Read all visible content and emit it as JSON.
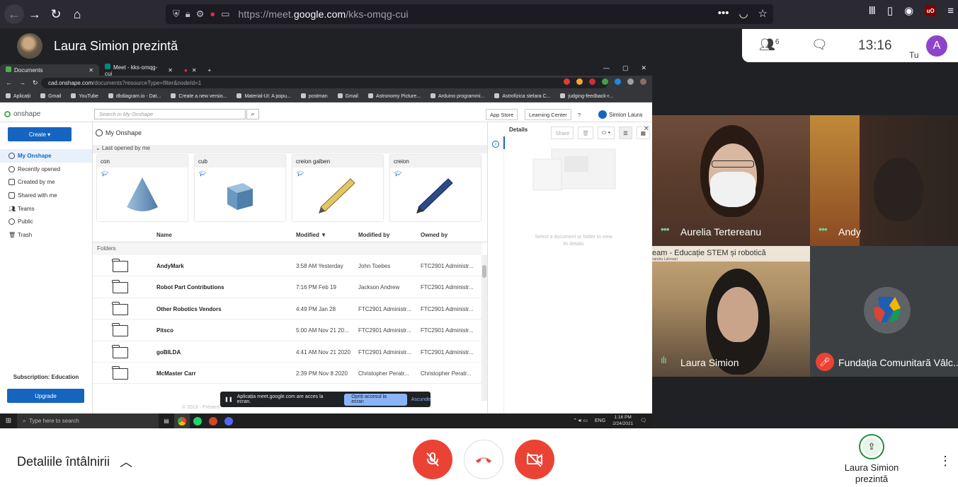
{
  "firefox": {
    "url_prefix": "https://meet.",
    "url_domain": "google.com",
    "url_path": "/kks-omqg-cui"
  },
  "meet": {
    "presenter_title": "Laura Simion prezintă",
    "participants_count": "6",
    "time": "13:16",
    "self_avatar_letter": "A",
    "self_label": "Tu",
    "meeting_details_label": "Detaliile întâlnirii",
    "presenting_label": "Laura Simion prezintă"
  },
  "chrome": {
    "tabs": [
      {
        "title": "Documents",
        "color": "#4caf50"
      },
      {
        "title": "Meet - kks-omqg-cui",
        "color": "#00897b"
      }
    ],
    "url_host": "cad.onshape.com",
    "url_path": "/documents?resourceType=filter&nodeId=1",
    "bookmarks": [
      "Aplicații",
      "Gmail",
      "YouTube",
      "dbdiagram.io - Dat...",
      "Create a new versio...",
      "Material-UI: A popu...",
      "postman",
      "Gmail",
      "Astronomy Picture...",
      "Arduino programmi...",
      "Astrofizica stelara C...",
      "judging-feedback-r..."
    ]
  },
  "onshape": {
    "logo": "onshape",
    "search_placeholder": "Search in My Onshape",
    "app_store": "App Store",
    "learning_center": "Learning Center",
    "help": "?",
    "user": "Simion Laura",
    "create": "Create ▾",
    "breadcrumb": "My Onshape",
    "share": "Share",
    "nav": [
      "My Onshape",
      "Recently opened",
      "Created by me",
      "Shared with me",
      "Teams",
      "Public",
      "Trash"
    ],
    "subscription": "Subscription: Education",
    "upgrade": "Upgrade",
    "last_opened": "Last opened by me",
    "cards": [
      "con",
      "cub",
      "creion galben",
      "creion"
    ],
    "columns": {
      "name": "Name",
      "modified": "Modified ▼",
      "modified_by": "Modified by",
      "owned_by": "Owned by"
    },
    "folders_header": "Folders",
    "rows": [
      {
        "name": "AndyMark",
        "modified": "3:58 AM Yesterday",
        "modified_by": "John Toebes",
        "owned_by": "FTC2901 Administr..."
      },
      {
        "name": "Robot Part Contributions",
        "modified": "7:16 PM Feb 19",
        "modified_by": "Jackson Andrew",
        "owned_by": "FTC2901 Administr..."
      },
      {
        "name": "Other Robotics Vendors",
        "modified": "4:49 PM Jan 28",
        "modified_by": "FTC2901 Administr...",
        "owned_by": "FTC2901 Administr..."
      },
      {
        "name": "Pitsco",
        "modified": "5:00 AM Nov 21 20...",
        "modified_by": "FTC2901 Administr...",
        "owned_by": "FTC2901 Administr..."
      },
      {
        "name": "goBILDA",
        "modified": "4:41 AM Nov 21 2020",
        "modified_by": "FTC2901 Administr...",
        "owned_by": "FTC2901 Administr..."
      },
      {
        "name": "McMaster Carr",
        "modified": "2:39 PM Nov 8 2020",
        "modified_by": "Christopher Peratr...",
        "owned_by": "Christopher Peratr..."
      }
    ],
    "footer": "© 2013 - Present",
    "details_title": "Details",
    "details_empty": "Select a document or folder to view its details"
  },
  "share_bar": {
    "message": "Aplicația meet.google.com are acces la ecran.",
    "stop": "Opriți accesul la ecran",
    "hide": "Ascunde"
  },
  "taskbar": {
    "search": "Type here to search",
    "lang": "ENG",
    "time": "1:16 PM",
    "date": "2/24/2021"
  },
  "participants": [
    {
      "name": "Aurelia Tertereanu",
      "muted": false
    },
    {
      "name": "Andy",
      "muted": false
    },
    {
      "name": "Laura Simion",
      "muted": false,
      "banner": "eam - Educație STEM și robotică",
      "banner_sub": "xandru Lahovari"
    },
    {
      "name": "Fundația Comunitară Vâlc...",
      "muted": true
    }
  ],
  "colors": {
    "danger": "#ea4335",
    "accent": "#1565c0",
    "meet_bg": "#202124",
    "speaking": "#81c995"
  }
}
